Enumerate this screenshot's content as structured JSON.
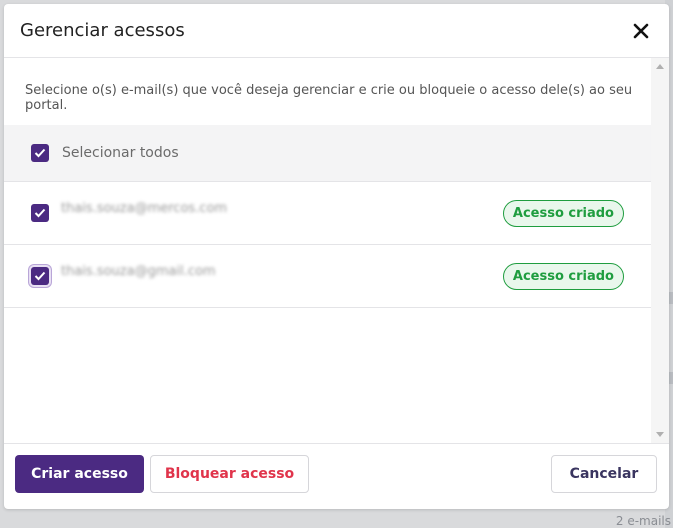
{
  "modal": {
    "title": "Gerenciar acessos",
    "intro": "Selecione o(s) e-mail(s) que você deseja gerenciar e crie ou bloqueie o acesso dele(s) ao seu portal.",
    "select_all_label": "Selecionar todos",
    "rows": [
      {
        "email": "thais.souza@mercos.com",
        "status": "Acesso criado",
        "checked": true
      },
      {
        "email": "thais.souza@gmail.com",
        "status": "Acesso criado",
        "checked": true
      }
    ]
  },
  "footer": {
    "create_label": "Criar acesso",
    "block_label": "Bloquear acesso",
    "cancel_label": "Cancelar"
  },
  "backdrop": {
    "count_text": "2 e-mails"
  },
  "colors": {
    "primary": "#4b2a82",
    "success": "#1f9d3f",
    "danger": "#e0344b"
  }
}
